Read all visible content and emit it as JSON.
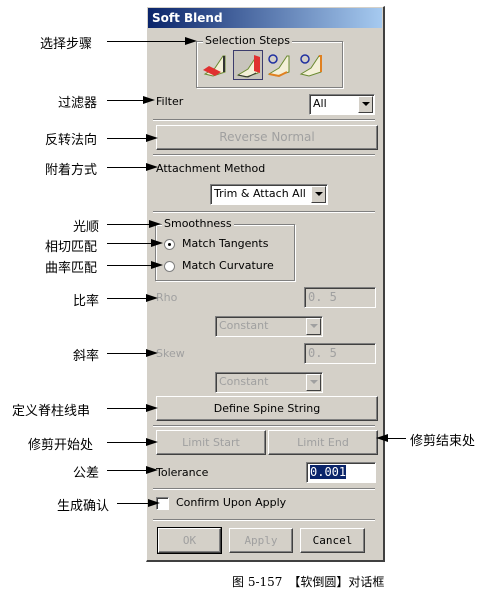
{
  "dialog": {
    "title": "Soft Blend",
    "selection_steps": {
      "legend": "Selection Steps",
      "steps": [
        {
          "icon": "first-face-set-icon",
          "active": false
        },
        {
          "icon": "second-face-set-icon",
          "active": true
        },
        {
          "icon": "first-tangent-curve-icon",
          "active": false
        },
        {
          "icon": "second-tangent-curve-icon",
          "active": false
        }
      ]
    },
    "filter": {
      "label": "Filter",
      "value": "All"
    },
    "reverse_normal": {
      "label": "Reverse Normal"
    },
    "attachment_method": {
      "label": "Attachment Method",
      "value": "Trim & Attach All"
    },
    "smoothness": {
      "legend": "Smoothness",
      "options": [
        {
          "label": "Match Tangents",
          "selected": true
        },
        {
          "label": "Match Curvature",
          "selected": false
        }
      ]
    },
    "rho": {
      "label": "Rho",
      "value": "0. 5",
      "law": "Constant"
    },
    "skew": {
      "label": "Skew",
      "value": "0. 5",
      "law": "Constant"
    },
    "define_spine": {
      "label": "Define Spine String"
    },
    "limit_start": {
      "label": "Limit Start"
    },
    "limit_end": {
      "label": "Limit End"
    },
    "tolerance": {
      "label": "Tolerance",
      "value": "0.001"
    },
    "confirm": {
      "label": "Confirm Upon Apply",
      "checked": false
    },
    "buttons": {
      "ok": "OK",
      "apply": "Apply",
      "cancel": "Cancel"
    }
  },
  "annotations": {
    "selection_steps": "选择步骤",
    "filter": "过滤器",
    "reverse_normal": "反转法向",
    "attachment_method": "附着方式",
    "smoothness": "光顺",
    "match_tangents": "相切匹配",
    "match_curvature": "曲率匹配",
    "rho": "比率",
    "skew": "斜率",
    "define_spine": "定义脊柱线串",
    "limit_start": "修剪开始处",
    "tolerance": "公差",
    "confirm": "生成确认",
    "limit_end": "修剪结束处"
  },
  "caption": "图 5-157　【软倒圆】对话框"
}
